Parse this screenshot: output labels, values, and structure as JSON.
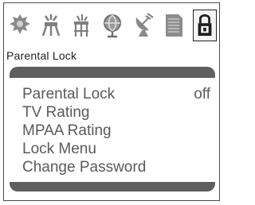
{
  "menu": {
    "title": "Parental Lock",
    "icons": [
      {
        "name": "picture-icon",
        "selected": false
      },
      {
        "name": "sound-icon",
        "selected": false
      },
      {
        "name": "timer-icon",
        "selected": false
      },
      {
        "name": "globe-icon",
        "selected": false
      },
      {
        "name": "satellite-dish-icon",
        "selected": false
      },
      {
        "name": "document-icon",
        "selected": false
      },
      {
        "name": "lock-icon",
        "selected": true
      }
    ],
    "items": [
      {
        "label": "Parental Lock",
        "value": "off"
      },
      {
        "label": "TV Rating"
      },
      {
        "label": "MPAA Rating"
      },
      {
        "label": "Lock Menu"
      },
      {
        "label": "Change Password"
      }
    ]
  },
  "colors": {
    "panel": "#5f5f5f",
    "text": "#5a5a5a",
    "frame": "#4a4a4a"
  }
}
